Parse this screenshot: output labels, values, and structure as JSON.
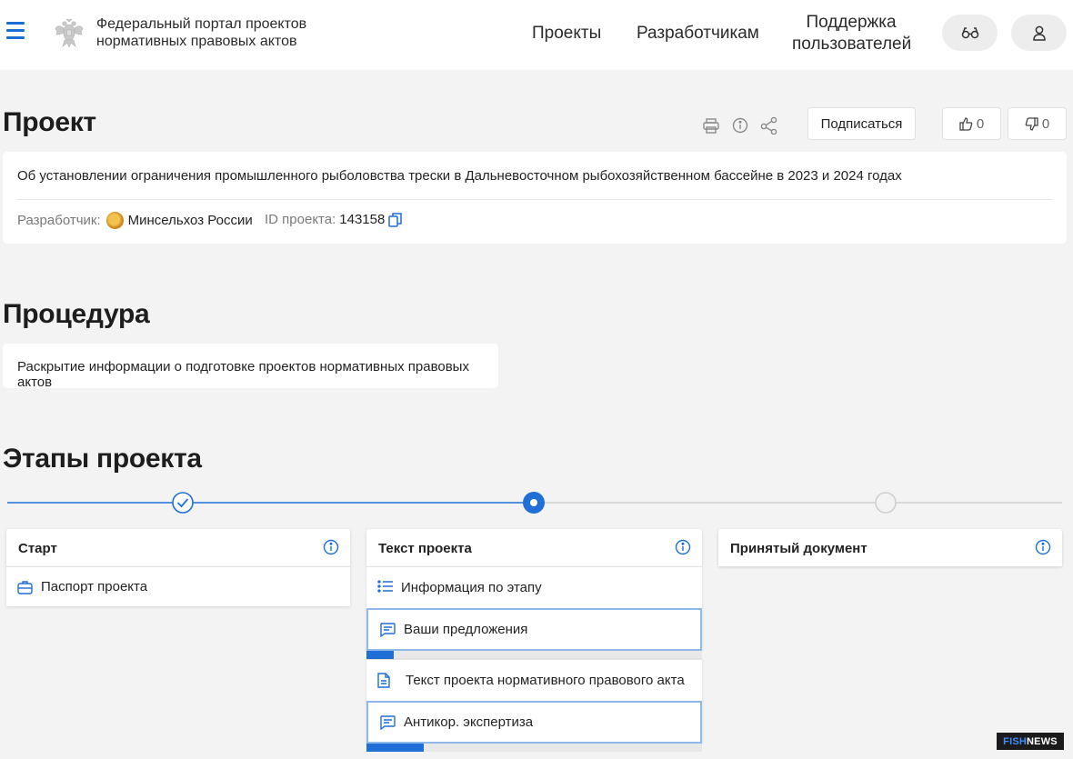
{
  "header": {
    "portal_title_line1": "Федеральный портал проектов",
    "portal_title_line2": "нормативных правовых актов",
    "nav": {
      "projects": "Проекты",
      "developers": "Разработчикам",
      "support_line1": "Поддержка",
      "support_line2": "пользователей"
    },
    "icons": [
      "menu-icon",
      "emblem-icon",
      "glasses-icon",
      "user-icon"
    ]
  },
  "project": {
    "heading": "Проект",
    "subscribe_label": "Подписаться",
    "likes": "0",
    "dislikes": "0",
    "description": "Об установлении ограничения промышленного рыболовства трески в Дальневосточном рыбохозяйственном бассейне в 2023 и 2024 годах",
    "developer_label": "Разработчик:",
    "developer_value": "Минсельхоз России",
    "id_label": "ID проекта:",
    "id_value": "143158"
  },
  "procedure": {
    "heading": "Процедура",
    "text": "Раскрытие информации о подготовке проектов нормативных правовых актов"
  },
  "stages": {
    "heading": "Этапы проекта",
    "columns": [
      {
        "title": "Старт",
        "status": "done",
        "rows": [
          {
            "label": "Паспорт проекта",
            "icon": "briefcase-icon"
          }
        ]
      },
      {
        "title": "Текст проекта",
        "status": "current",
        "rows": [
          {
            "label": "Информация по этапу",
            "icon": "list-icon"
          },
          {
            "label": "Ваши предложения",
            "icon": "comment-icon",
            "progress": 0.08
          },
          {
            "label": "Текст проекта нормативного правового акта",
            "icon": "document-icon"
          },
          {
            "label": "Антикор. экспертиза",
            "icon": "comment-icon",
            "progress": 0.17
          }
        ]
      },
      {
        "title": "Принятый документ",
        "status": "pending",
        "rows": []
      }
    ]
  },
  "watermark": {
    "part1": "FISH",
    "part2": "NEWS"
  },
  "colors": {
    "accent": "#1f6fd6",
    "background": "#f3f3f3",
    "card": "#ffffff"
  }
}
